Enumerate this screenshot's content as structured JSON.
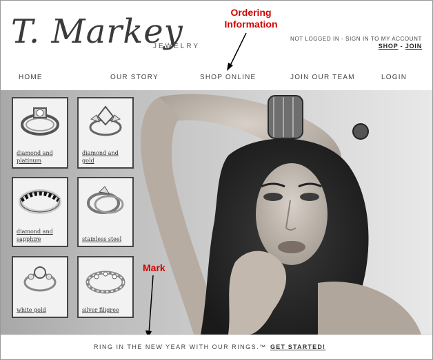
{
  "header": {
    "logo": "T. Markey",
    "logo_sub": "JEWELRY",
    "account_status": "NOT LOGGED IN - SIGN IN TO MY ACCOUNT",
    "shop_link": "SHOP",
    "separator": "-",
    "join_link": "JOIN"
  },
  "annotations": {
    "ordering_line1": "Ordering",
    "ordering_line2": "Information",
    "mark": "Mark"
  },
  "nav": {
    "items": [
      {
        "label": "HOME"
      },
      {
        "label": "OUR STORY"
      },
      {
        "label": "SHOP ONLINE"
      },
      {
        "label": "JOIN OUR TEAM"
      },
      {
        "label": "LOGIN"
      }
    ]
  },
  "tiles": [
    {
      "line1": "diamond and",
      "line2": "platinum",
      "icon": "ring-platinum-icon"
    },
    {
      "line1": "diamond and",
      "line2": "gold",
      "icon": "ring-gold-icon"
    },
    {
      "line1": "diamond and",
      "line2": "sapphire",
      "icon": "ring-sapphire-icon"
    },
    {
      "line1": "stainless steel",
      "line2": "",
      "icon": "ring-steel-icon"
    },
    {
      "line1": "white gold",
      "line2": "",
      "icon": "ring-white-gold-icon"
    },
    {
      "line1": "silver filigree",
      "line2": "",
      "icon": "ring-filigree-icon"
    }
  ],
  "footer": {
    "tagline": "RING IN THE NEW YEAR WITH OUR RINGS.™",
    "cta": "GET STARTED!"
  },
  "colors": {
    "annotation": "#d40000",
    "text": "#333333"
  }
}
